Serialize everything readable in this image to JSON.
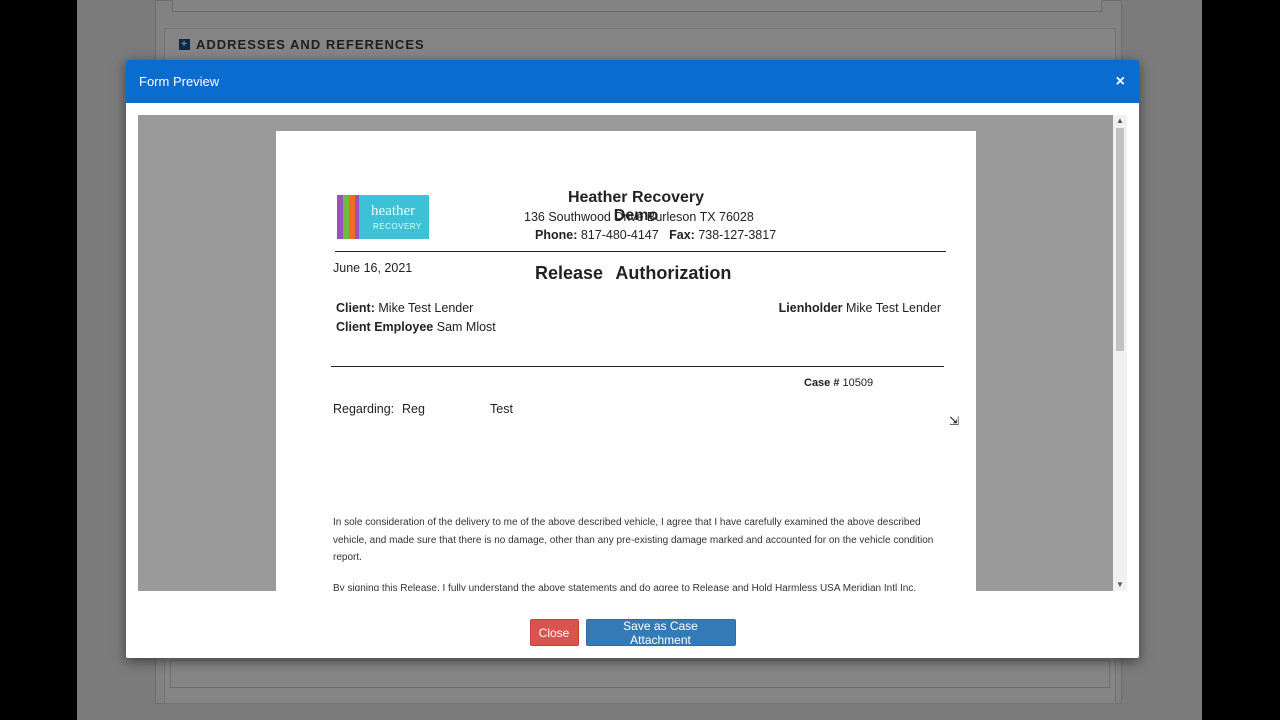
{
  "background": {
    "section_heading": "ADDRESSES AND REFERENCES",
    "section_heading_icon": "plus-square-icon"
  },
  "modal": {
    "title": "Form Preview",
    "close_icon": "×",
    "header_color": "#0a6ccf"
  },
  "document": {
    "logo": {
      "word": "heather",
      "sub": "RECOVERY"
    },
    "company_name": "Heather Recovery Demo",
    "address": "136 Southwood Drive   Burleson   TX   76028",
    "phone_label": "Phone:",
    "phone": "817-480-4147",
    "fax_label": "Fax:",
    "fax": "738-127-3817",
    "date": "June 16, 2021",
    "title": "Release Authorization",
    "client_label": "Client:",
    "client": "Mike Test Lender",
    "client_employee_label": "Client Employee",
    "client_employee": "Sam Mlost",
    "lienholder_label": "Lienholder",
    "lienholder": "Mike Test Lender",
    "case_label": "Case #",
    "case_number": "10509",
    "regarding_label": "Regarding:",
    "regarding_value_1": "Reg",
    "regarding_value_2": "Test",
    "body_paragraph_1": "In sole consideration of the delivery to me of the above described vehicle, I agree that I have carefully examined the above described vehicle, and made sure that there is no damage, other than any pre-existing damage marked and accounted for on the vehicle condition report.",
    "body_paragraph_2": "By signing this Release, I fully understand the above statements and do agree to Release and Hold Harmless USA Meridian Intl Inc."
  },
  "footer": {
    "close_label": "Close",
    "save_label": "Save as Case Attachment",
    "close_color": "#d9534f",
    "save_color": "#337ab7"
  }
}
